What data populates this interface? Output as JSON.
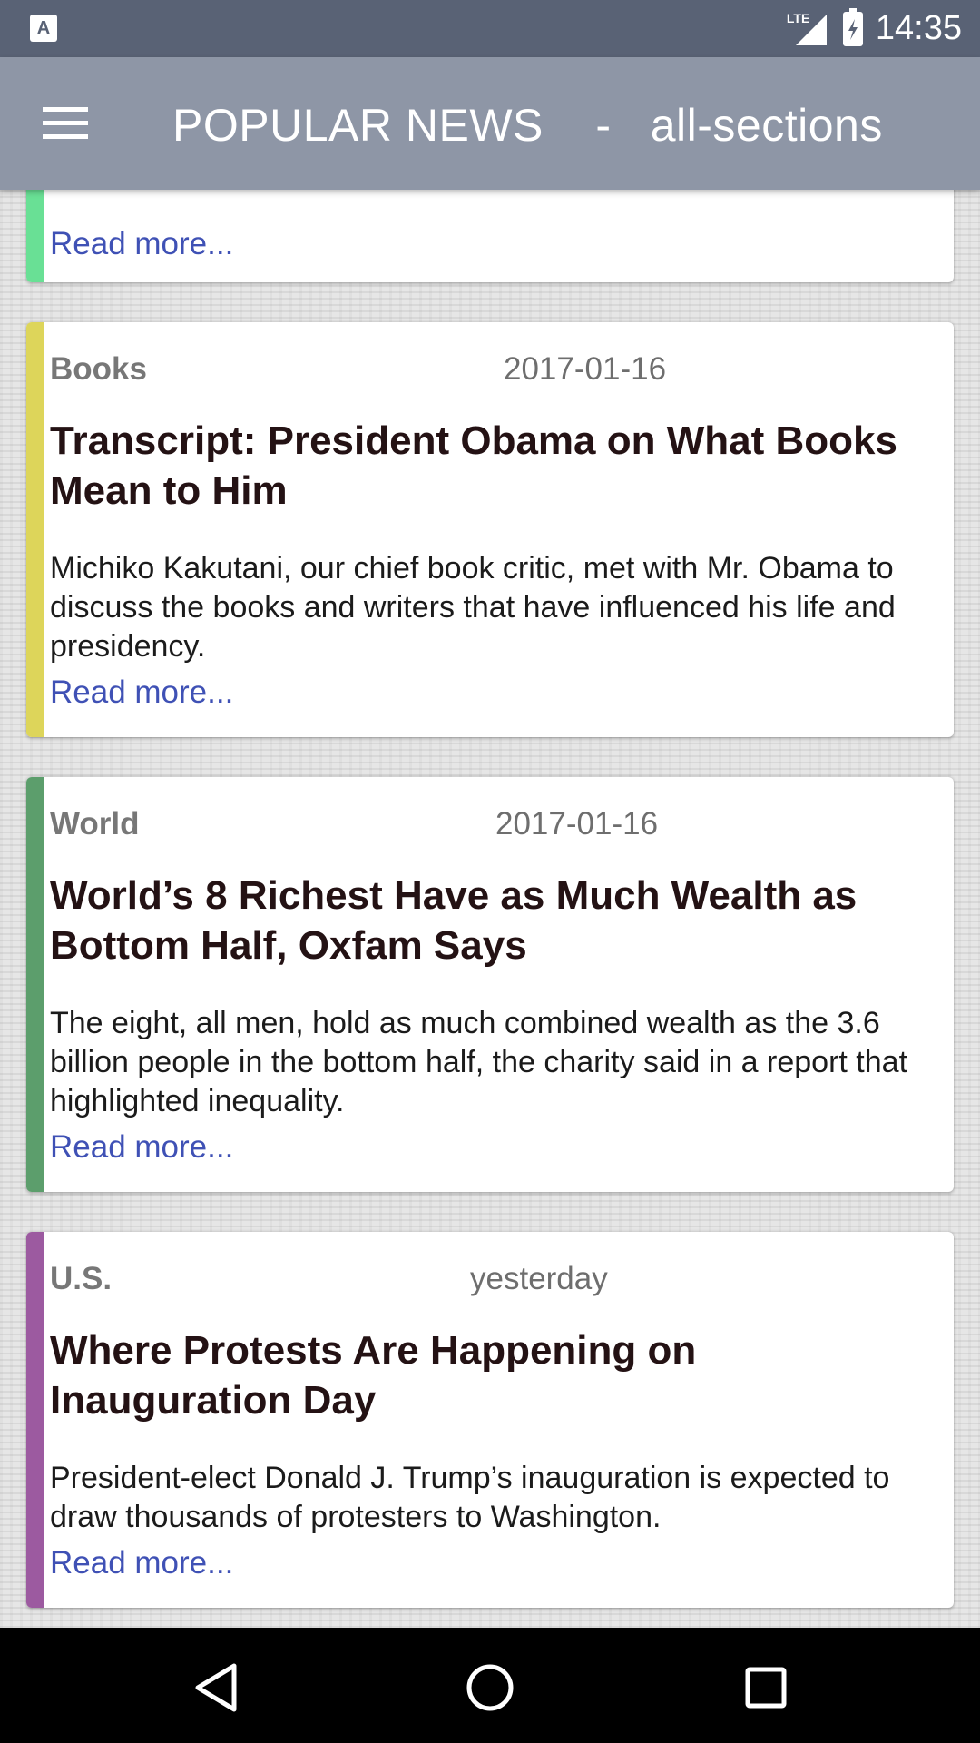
{
  "status_bar": {
    "time": "14:35",
    "network": "LTE",
    "icons": [
      "notification-a-icon",
      "signal-icon",
      "battery-icon"
    ]
  },
  "app_bar": {
    "title": "POPULAR NEWS    -   all-sections",
    "menu_icon": "hamburger-menu-icon"
  },
  "articles": [
    {
      "read_more": "Read more...",
      "accent": "#69e095"
    },
    {
      "section": "Books",
      "date": "2017-01-16",
      "headline": "Transcript: President Obama on What Books Mean to Him",
      "summary": "Michiko Kakutani, our chief book critic, met with Mr. Obama to discuss the books and writers that have influenced his life and presidency.",
      "read_more": "Read more...",
      "accent": "#ddd55a"
    },
    {
      "section": "World",
      "date": "2017-01-16",
      "headline": "World’s 8 Richest Have as Much Wealth as Bottom Half, Oxfam Says",
      "summary": "The eight, all men, hold as much combined wealth as the 3.6 billion people in the bottom half, the charity said in a report that highlighted inequality.",
      "read_more": "Read more...",
      "accent": "#5c9e6c"
    },
    {
      "section": "U.S.",
      "date": "yesterday",
      "headline": "Where Protests Are Happening on Inauguration Day",
      "summary": "President-elect Donald J. Trump’s inauguration is expected to draw thousands of protesters to Washington.",
      "read_more": "Read more...",
      "accent": "#9c5aa0"
    }
  ],
  "nav_bar": {
    "icons": [
      "back-icon",
      "home-icon",
      "recents-icon"
    ]
  },
  "colors": {
    "status_bar": "#596275",
    "app_bar": "#8e96a6",
    "link": "#3f51b5"
  }
}
